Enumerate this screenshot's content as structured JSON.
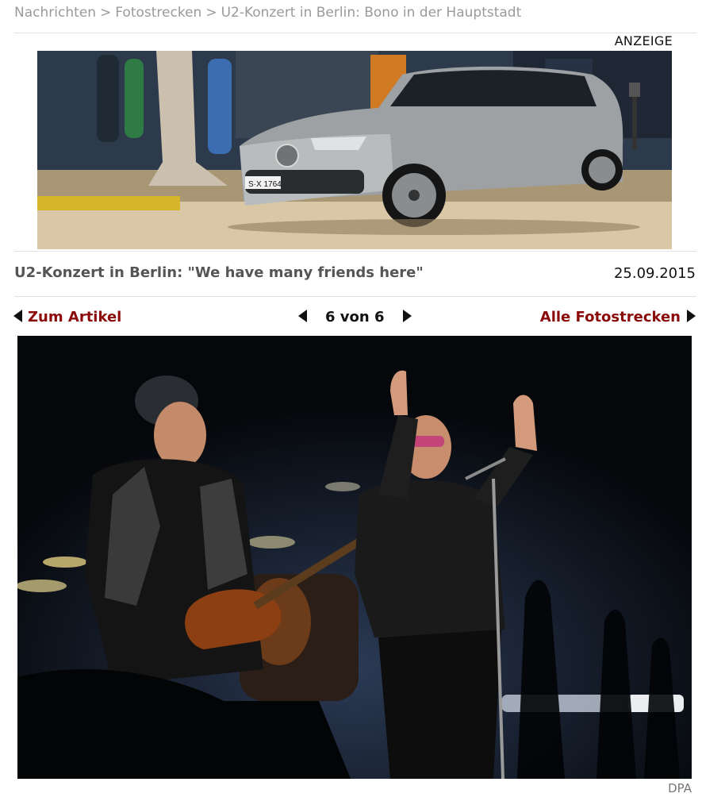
{
  "breadcrumb": {
    "items": [
      "Nachrichten",
      "Fotostrecken",
      "U2-Konzert in Berlin: Bono in der Hauptstadt"
    ],
    "separator": ">"
  },
  "ad": {
    "label": "ANZEIGE",
    "image_description_icon": "car-advertisement-image",
    "plate": "S·X 1764"
  },
  "gallery": {
    "title": "U2-Konzert in Berlin: \"We have many friends here\"",
    "date": "25.09.2015",
    "back_link": "Zum Artikel",
    "counter": "6 von 6",
    "all_link": "Alle Fotostrecken",
    "credit": "DPA"
  },
  "colors": {
    "link": "#8b0a0a",
    "breadcrumb": "#9a9a9a",
    "title": "#555555"
  }
}
